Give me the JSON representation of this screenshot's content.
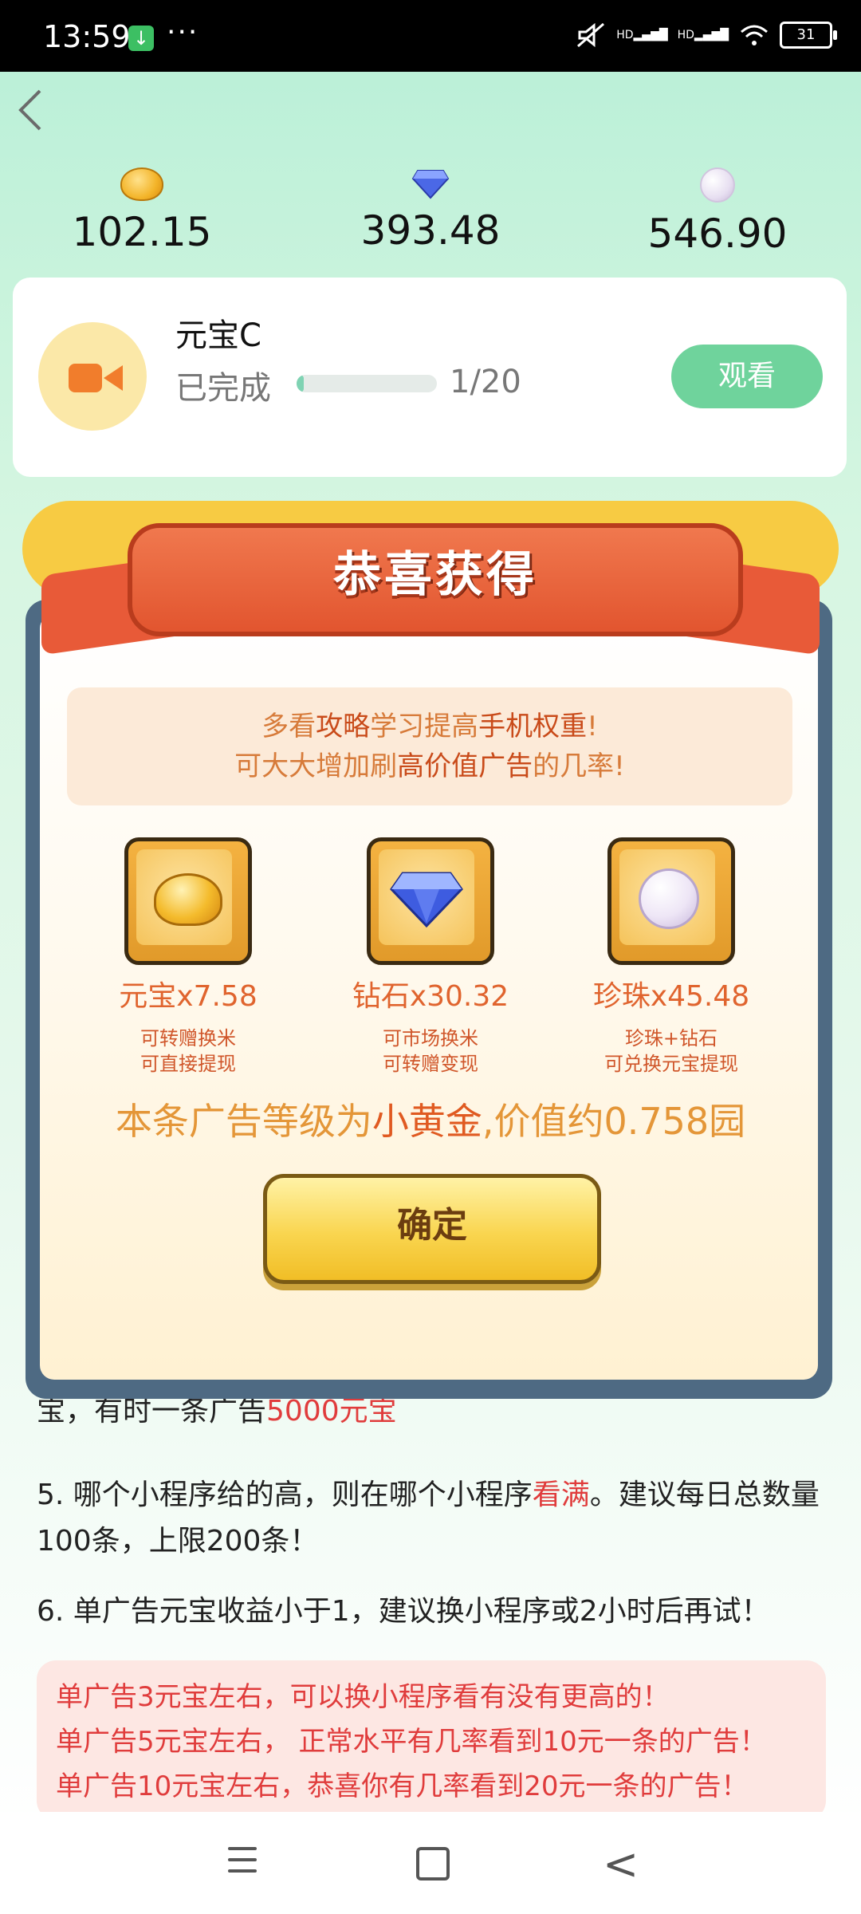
{
  "status_bar": {
    "time": "13:59",
    "download_badge": "↓",
    "more": "···",
    "battery": "31",
    "signal_label_1": "HD",
    "signal_label_2": "HD"
  },
  "header": {
    "back_icon": "chevron-left-icon",
    "balances": [
      {
        "icon": "gold-ingot-icon",
        "value": "102.15"
      },
      {
        "icon": "diamond-icon",
        "value": "393.48"
      },
      {
        "icon": "pearl-icon",
        "value": "546.90"
      }
    ]
  },
  "task": {
    "title": "元宝C",
    "status": "已完成",
    "progress": {
      "current": 1,
      "total": 20,
      "fraction": 0.05
    },
    "count_text": "1/20",
    "button_label": "观看",
    "icon": "video-camera-icon"
  },
  "dialog": {
    "title": "恭喜获得",
    "notice_line1_pre": "多看",
    "notice_line1_hl1": "攻略",
    "notice_line1_mid": "学习提高",
    "notice_line1_hl2": "手机权重",
    "notice_line1_post": "!",
    "notice_line2_pre": "可大大增加刷",
    "notice_line2_hl": "高价值广告",
    "notice_line2_post": "的几率!",
    "rewards": [
      {
        "icon": "gold-ingot-icon",
        "label": "元宝x7.58",
        "desc1": "可转赠换米",
        "desc2": "可直接提现"
      },
      {
        "icon": "diamond-icon",
        "label": "钻石x30.32",
        "desc1": "可市场换米",
        "desc2": "可转赠变现"
      },
      {
        "icon": "pearl-icon",
        "label": "珍珠x45.48",
        "desc1": "珍珠+钻石",
        "desc2": "可兑换元宝提现"
      }
    ],
    "value_pre": "本条广告等级为",
    "value_hl": "小黄金",
    "value_post": ",价值约0.758园",
    "confirm_label": "确定"
  },
  "content": {
    "partial_line_pre": "宝，有时一条广告",
    "partial_line_red": "5000元宝",
    "item5_pre": "5. 哪个小程序给的高，则在哪个小程序",
    "item5_red": "看满",
    "item5_post": "。建议每日总数量100条，上限200条！",
    "item6": "6. 单广告元宝收益小于1，建议换小程序或2小时后再试！",
    "tips": [
      "单广告3元宝左右，可以换小程序看有没有更高的！",
      "单广告5元宝左右， 正常水平有几率看到10元一条的广告！",
      "单广告10元宝左右，恭喜你有几率看到20元一条的广告！"
    ]
  },
  "nav": {
    "menu_icon": "menu-icon",
    "home_icon": "home-icon",
    "back_icon": "back-icon",
    "back_glyph": "<"
  },
  "colors": {
    "accent_green": "#6fd39c",
    "ribbon": "#e2552f",
    "confirm": "#f9d54f",
    "highlight_red": "#e03c3c"
  }
}
